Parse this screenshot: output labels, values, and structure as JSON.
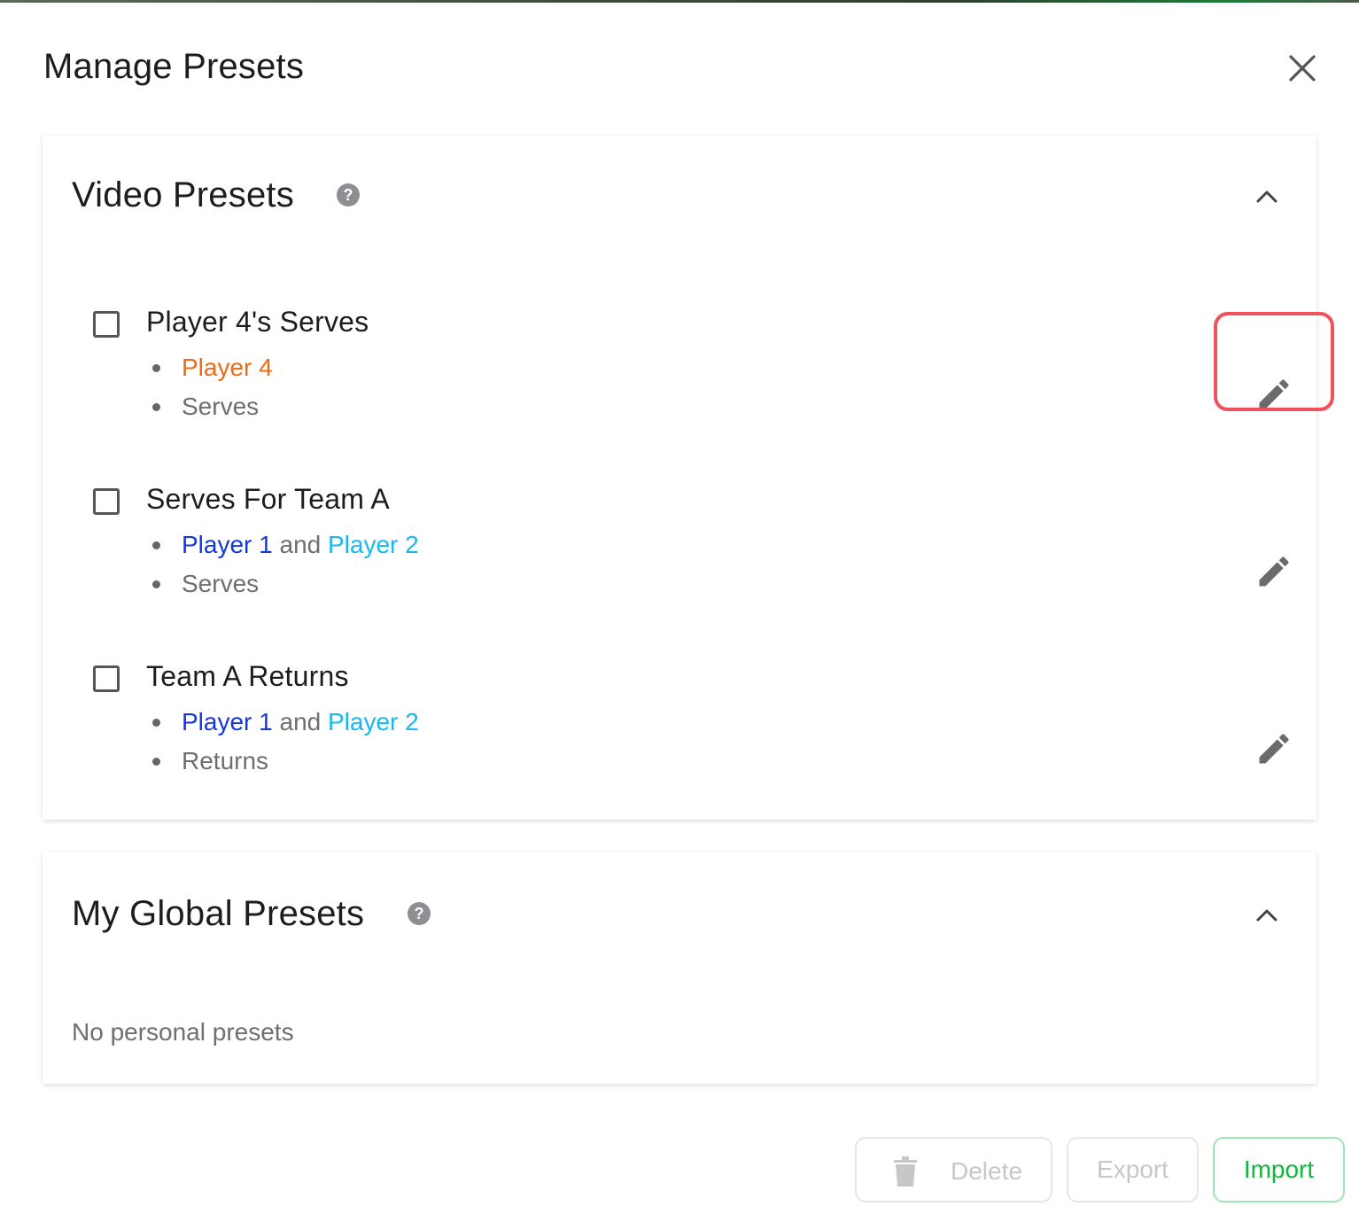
{
  "modal": {
    "title": "Manage Presets",
    "close_label": "Close"
  },
  "video_presets": {
    "title": "Video Presets",
    "presets": [
      {
        "name": "Player 4's Serves",
        "players": [
          {
            "label": "Player 4",
            "color": "#f06a15"
          }
        ],
        "joiner": "",
        "action": "Serves"
      },
      {
        "name": "Serves For Team A",
        "players": [
          {
            "label": "Player 1",
            "color": "#1438e0"
          },
          {
            "label": "Player 2",
            "color": "#1ab8ee"
          }
        ],
        "joiner": "and",
        "action": "Serves"
      },
      {
        "name": "Team A Returns",
        "players": [
          {
            "label": "Player 1",
            "color": "#1438e0"
          },
          {
            "label": "Player 2",
            "color": "#1ab8ee"
          }
        ],
        "joiner": "and",
        "action": "Returns"
      }
    ]
  },
  "global_presets": {
    "title": "My Global Presets",
    "empty_message": "No personal presets"
  },
  "footer": {
    "delete_label": "Delete",
    "export_label": "Export",
    "import_label": "Import"
  },
  "colors": {
    "highlight": "#f0525c",
    "import_accent": "#12b83a",
    "disabled_text": "#c7c7c7"
  }
}
